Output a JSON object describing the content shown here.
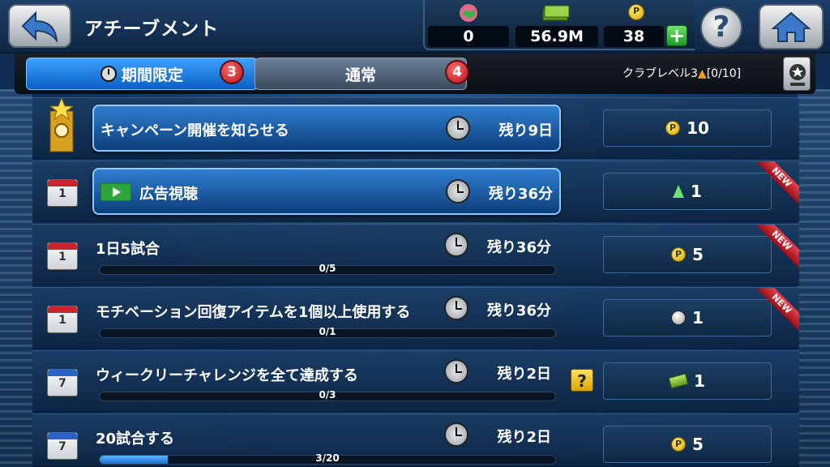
{
  "header": {
    "title": "アチーブメント",
    "currencies": [
      {
        "icon": "handshake-icon",
        "value": "0"
      },
      {
        "icon": "cash-icon",
        "value": "56.9M"
      },
      {
        "icon": "gp-coin-icon",
        "value": "38"
      }
    ],
    "plus_label": "+",
    "help_label": "?"
  },
  "tabs": [
    {
      "label": "期間限定",
      "badge": "3",
      "active": true
    },
    {
      "label": "通常",
      "badge": "4",
      "active": false
    }
  ],
  "club_level": "クラブレベル3",
  "club_level_progress": "[0/10]",
  "achievements": [
    {
      "title": "キャンペーン開催を知らせる",
      "remaining": "残り9日",
      "reward_icon": "gp-coin-icon",
      "reward": "10",
      "is_button": true,
      "is_new": false,
      "icon": "campaign-star-icon"
    },
    {
      "title": "広告視聴",
      "remaining": "残り36分",
      "reward_icon": "club-level-arrow-icon",
      "reward": "1",
      "is_button": true,
      "is_new": true,
      "icon": "calendar-1-icon",
      "calendar_label": "1"
    },
    {
      "title": "1日5試合",
      "remaining": "残り36分",
      "progress_text": "0/5",
      "progress": 0,
      "reward_icon": "gp-coin-icon",
      "reward": "5",
      "is_new": true,
      "icon": "calendar-1-icon",
      "calendar_label": "1"
    },
    {
      "title": "モチベーション回復アイテムを1個以上使用する",
      "remaining": "残り36分",
      "progress_text": "0/1",
      "progress": 0,
      "reward_icon": "soccer-ball-icon",
      "reward": "1",
      "is_new": true,
      "icon": "calendar-1-icon",
      "calendar_label": "1"
    },
    {
      "title": "ウィークリーチャレンジを全て達成する",
      "remaining": "残り2日",
      "progress_text": "0/3",
      "progress": 0,
      "reward_icon": "cash-bundle-icon",
      "reward": "1",
      "is_new": false,
      "has_help": true,
      "help_label": "?",
      "icon": "calendar-7-icon",
      "calendar_label": "7"
    },
    {
      "title": "20試合する",
      "remaining": "残り2日",
      "progress_text": "3/20",
      "progress": 0.15,
      "reward_icon": "gp-coin-icon",
      "reward": "5",
      "is_new": false,
      "icon": "calendar-7-icon",
      "calendar_label": "7"
    }
  ],
  "new_label": "NEW",
  "coin_symbol": "P",
  "colors": {
    "accent": "#0a5fc4",
    "badge": "#b0121c",
    "progress": "#1a6fd0"
  }
}
